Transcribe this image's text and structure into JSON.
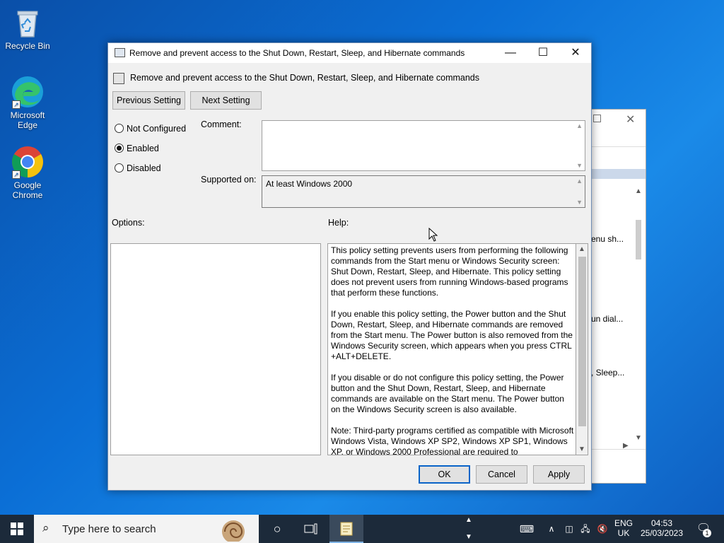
{
  "desktop": {
    "icons": [
      {
        "label": "Recycle Bin"
      },
      {
        "label": "Microsoft Edge"
      },
      {
        "label": "Google Chrome"
      }
    ]
  },
  "background_window": {
    "items": [
      "enu sh...",
      "un dial...",
      ", Sleep..."
    ]
  },
  "dialog": {
    "title": "Remove and prevent access to the Shut Down, Restart, Sleep, and Hibernate commands",
    "header": "Remove and prevent access to the Shut Down, Restart, Sleep, and Hibernate commands",
    "prev_button": "Previous Setting",
    "next_button": "Next Setting",
    "radio": {
      "not_configured": "Not Configured",
      "enabled": "Enabled",
      "disabled": "Disabled",
      "selected": "Enabled"
    },
    "comment_label": "Comment:",
    "comment_value": "",
    "supported_label": "Supported on:",
    "supported_value": "At least Windows 2000",
    "options_label": "Options:",
    "help_label": "Help:",
    "help_paragraphs": [
      "This policy setting prevents users from performing the following commands from the Start menu or Windows Security screen: Shut Down, Restart, Sleep, and Hibernate. This policy setting does not prevent users from running Windows-based programs that perform these functions.",
      "If you enable this policy setting, the Power button and the Shut Down, Restart, Sleep, and Hibernate commands are removed from the Start menu. The Power button is also removed from the Windows Security screen, which appears when you press CTRL +ALT+DELETE.",
      "If you disable or do not configure this policy setting, the Power button and the Shut Down, Restart, Sleep, and Hibernate commands are available on the Start menu. The Power button on the Windows Security screen is also available.",
      "Note: Third-party programs certified as compatible with Microsoft Windows Vista, Windows XP SP2, Windows XP SP1, Windows XP, or Windows 2000 Professional are required to"
    ],
    "ok_button": "OK",
    "cancel_button": "Cancel",
    "apply_button": "Apply"
  },
  "taskbar": {
    "search_placeholder": "Type here to search",
    "language_top": "ENG",
    "language_bottom": "UK",
    "time": "04:53",
    "date": "25/03/2023",
    "notification_count": "1"
  },
  "colors": {
    "accent": "#0a64c8",
    "taskbar": "#1c2a3a",
    "desktop": "#0b6fd6"
  }
}
